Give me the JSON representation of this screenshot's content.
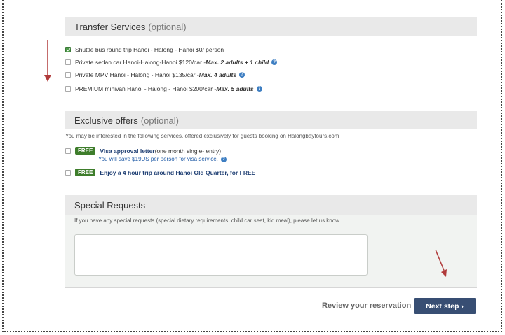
{
  "transfer": {
    "title": "Transfer Services",
    "optional": "(optional)",
    "options": [
      {
        "label": "Shuttle bus round trip Hanoi - Halong - Hanoi $0/ person",
        "note": "",
        "checked": true,
        "help": false
      },
      {
        "label": "Private sedan car Hanoi-Halong-Hanoi $120/car - ",
        "note": "Max. 2 adults + 1 child",
        "checked": false,
        "help": true
      },
      {
        "label": "Private MPV Hanoi - Halong - Hanoi $135/car - ",
        "note": "Max. 4 adults",
        "checked": false,
        "help": true
      },
      {
        "label": "PREMIUM minivan Hanoi - Halong - Hanoi $200/car - ",
        "note": "Max. 5 adults",
        "checked": false,
        "help": true
      }
    ]
  },
  "offers": {
    "title": "Exclusive offers",
    "optional": "(optional)",
    "note": "You may be interested in the following services, offered exclusively for guests booking on Halongbaytours.com",
    "badge": "FREE",
    "visa": {
      "title": "Visa approval letter",
      "detail": " (one month single- entry)",
      "save": "You will save $19US per person for visa service."
    },
    "tour": {
      "label": "Enjoy a 4 hour trip around Hanoi Old Quarter, for FREE"
    }
  },
  "special": {
    "title": "Special Requests",
    "note": "If you have any special requests (special dietary requirements, child car seat, kid meal), please let us know.",
    "value": ""
  },
  "footer": {
    "review_label": "Review your reservation",
    "next_label": "Next step ›"
  },
  "colors": {
    "button": "#384e73",
    "free_badge": "#3e7d2b",
    "annotation_arrow": "#b03a3a"
  }
}
